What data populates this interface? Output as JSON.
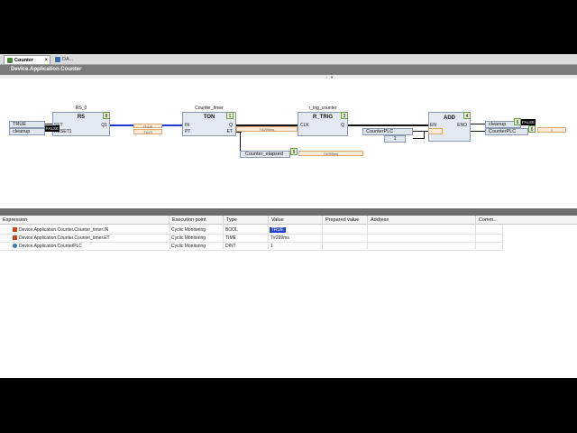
{
  "tabs": [
    {
      "label": "Counter",
      "close": "×"
    },
    {
      "label": "DA..."
    }
  ],
  "path_title": "Device.Application.Counter",
  "grip_glyph": "↕ ▼",
  "diagram": {
    "vars": {
      "true_in": "TRUE",
      "cleanup_in": "cleanup",
      "counter_elapsed": "Counter_elapsed",
      "counter_plc_add": "CounterPLC",
      "one": "1",
      "cleanup_out": "cleanup",
      "counter_plc_out": "CounterPLC"
    },
    "blocks": {
      "rs": {
        "instance": "RS_0",
        "title": "RS",
        "pin_set": "SET",
        "pin_reset": "RESET1",
        "pin_q": "Q1",
        "id": "8"
      },
      "ton": {
        "instance": "Counter_timer",
        "title": "TON",
        "pin_in": "IN",
        "pin_pt": "PT",
        "pin_q": "Q",
        "pin_et": "ET",
        "id": "1"
      },
      "rtrig": {
        "instance": "r_trig_counter",
        "title": "R_TRIG",
        "pin_clk": "CLK",
        "pin_q": "Q",
        "id": "3"
      },
      "add": {
        "title": "ADD",
        "pin_en": "EN",
        "pin_eno": "ENO",
        "id": "4"
      }
    },
    "badges": {
      "elapsed": "5",
      "cleanup_out": "6",
      "plc_out": "6"
    },
    "online": {
      "rs_q": "TRUE",
      "pt": "T#1S",
      "ton_q": "T#299ms",
      "elapsed": "T#299ms",
      "add_out": "1"
    },
    "bool_flags": {
      "reset": "FALSE",
      "cleanup_out": "FALSE"
    }
  },
  "watch": {
    "columns": [
      "Expression",
      "Execution point",
      "Type",
      "Value",
      "Prepared value",
      "Address",
      "Comm..."
    ],
    "rows": [
      {
        "expression": "Device.Application.Counter.Counter_timer.IN",
        "exec": "Cyclic Monitoring",
        "type": "BOOL",
        "value": "TRUE",
        "selected": true
      },
      {
        "expression": "Device.Application.Counter.Counter_timer.ET",
        "exec": "Cyclic Monitoring",
        "type": "TIME",
        "value": "T#299ms",
        "selected": false
      },
      {
        "expression": "Device.Application.CounterPLC",
        "exec": "Cyclic Monitoring",
        "type": "DINT",
        "value": "1",
        "selected": false
      }
    ]
  },
  "colors": {
    "selected_value_bg": "#1e3fd0",
    "path_bar": "#7b7b7b",
    "fb_fill": "#e4eaf2",
    "online_fill": "#fdebd6"
  }
}
